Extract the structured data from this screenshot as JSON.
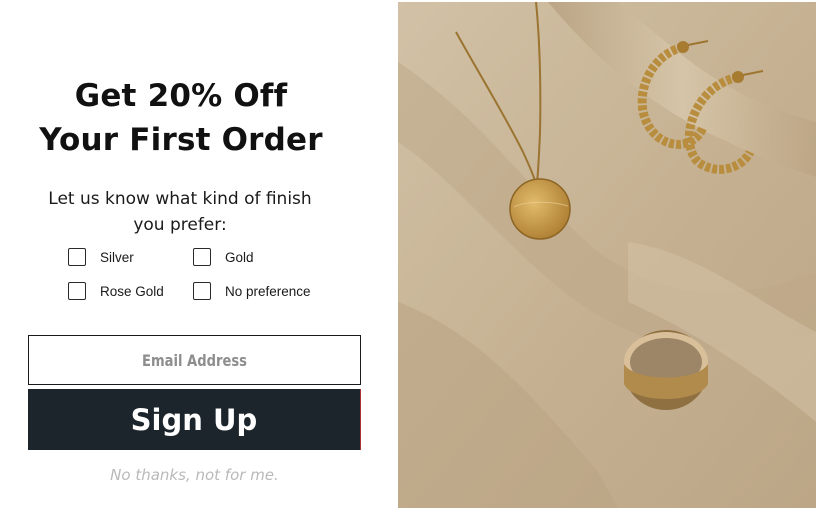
{
  "popup": {
    "headline_line1": "Get 20% Off",
    "headline_line2": "Your First Order",
    "prompt": "Let us know what kind of finish you prefer:",
    "options": [
      {
        "label": "Silver",
        "checked": false
      },
      {
        "label": "Gold",
        "checked": false
      },
      {
        "label": "Rose Gold",
        "checked": false
      },
      {
        "label": "No preference",
        "checked": false
      }
    ],
    "email_placeholder": "Email Address",
    "email_value": "",
    "signup_label": "Sign Up",
    "decline_label": "No thanks, not for me."
  },
  "colors": {
    "button_bg": "#1b252b",
    "button_text": "#ffffff",
    "decline_text": "#b9b9b9",
    "photo_bg": "#c8b599",
    "gold": "#c49a4a"
  },
  "image": {
    "subject": "gold necklace, hoop earrings and ring on beige fabric"
  }
}
